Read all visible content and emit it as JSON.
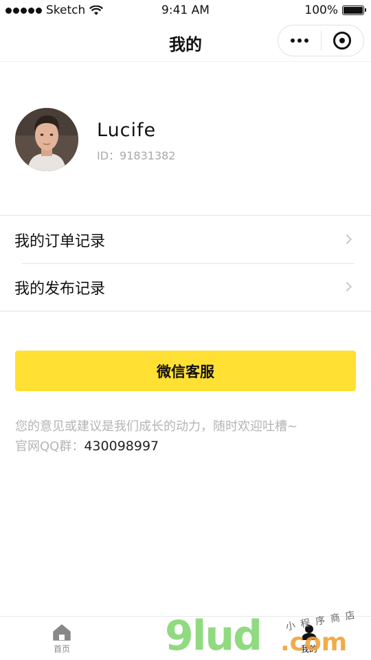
{
  "status_bar": {
    "carrier": "Sketch",
    "time": "9:41 AM",
    "battery_percent": "100%",
    "battery_level": 1.0
  },
  "nav": {
    "title": "我的",
    "more_icon": "more-dots-icon",
    "close_icon": "target-icon"
  },
  "profile": {
    "name": "Lucife",
    "id_text": "ID：91831382"
  },
  "menu": {
    "items": [
      {
        "label": "我的订单记录"
      },
      {
        "label": "我的发布记录"
      }
    ]
  },
  "service": {
    "button_label": "微信客服"
  },
  "feedback": {
    "text": "您的意见或建议是我们成长的动力，随时欢迎吐槽~",
    "qq_label": "官网QQ群：",
    "qq_number": "430098997"
  },
  "tab_bar": {
    "tabs": [
      {
        "label": "首页",
        "icon": "home-icon"
      },
      {
        "label": "我的",
        "icon": "user-icon"
      }
    ]
  },
  "watermark": {
    "brand": "9lud",
    "domain": ".com",
    "tagline": "小程序商店"
  },
  "colors": {
    "accent": "#ffe033",
    "muted_text": "#b4b4b4",
    "divider": "#e4e4e4"
  }
}
